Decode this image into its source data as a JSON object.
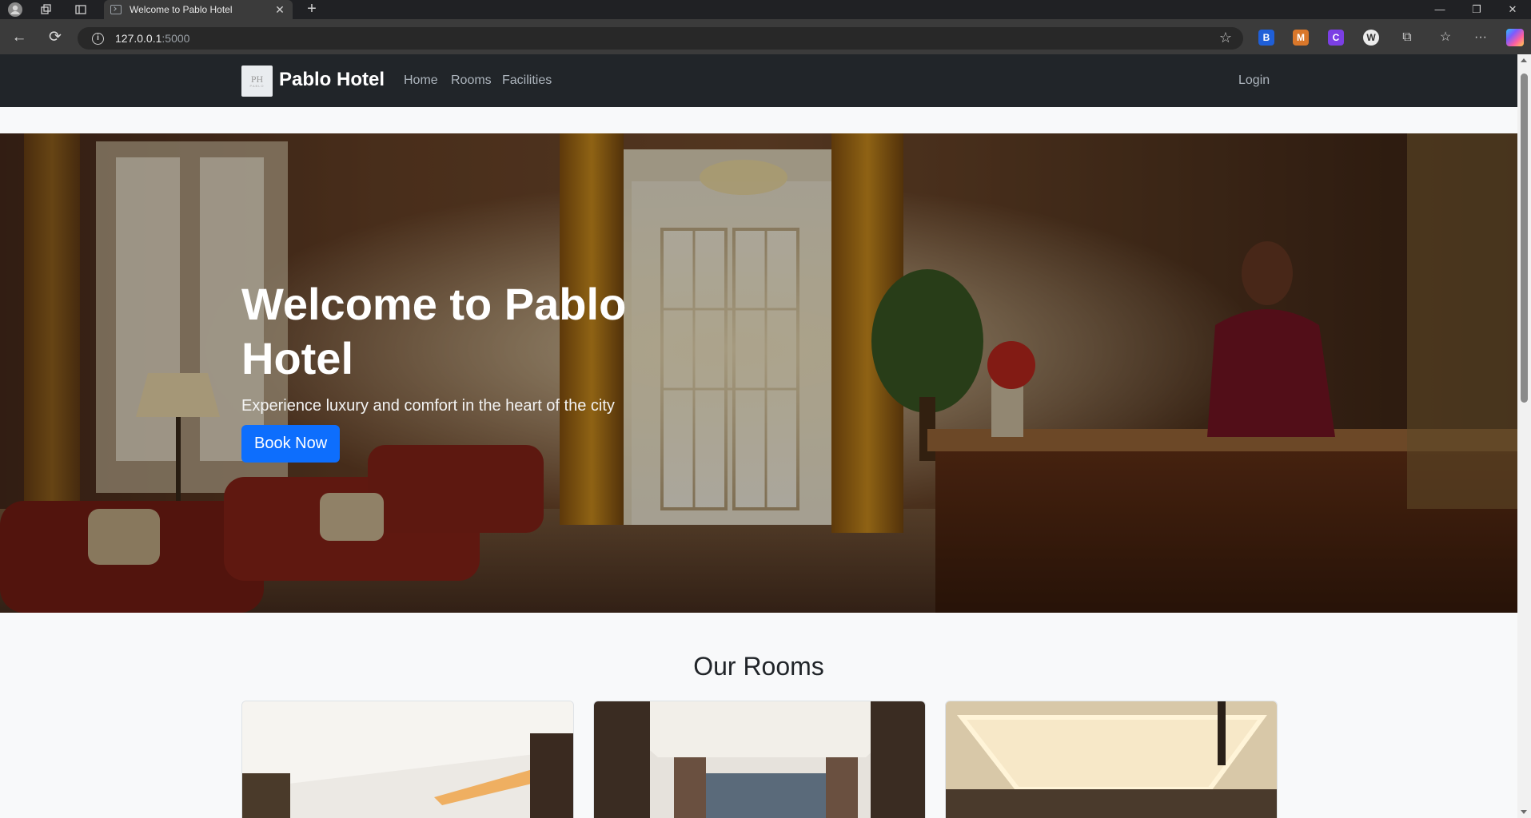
{
  "browser": {
    "tab_title": "Welcome to Pablo Hotel",
    "url_host": "127.0.0.1",
    "url_port": ":5000"
  },
  "navbar": {
    "logo_text": "PH",
    "logo_subtext": "PABLO",
    "brand": "Pablo Hotel",
    "links": [
      "Home",
      "Rooms",
      "Facilities"
    ],
    "login": "Login"
  },
  "hero": {
    "title": "Welcome to Pablo Hotel",
    "subtitle": "Experience luxury and comfort in the heart of the city",
    "button": "Book Now"
  },
  "rooms": {
    "title": "Our Rooms",
    "cards": [
      {
        "image": "room-photo-1"
      },
      {
        "image": "room-photo-2"
      },
      {
        "image": "room-photo-3"
      }
    ]
  },
  "colors": {
    "navbar_bg": "#212529",
    "primary": "#0d6efd",
    "page_bg": "#f8f9fa"
  }
}
